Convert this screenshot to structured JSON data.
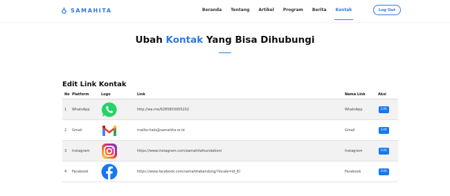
{
  "brand": {
    "name": "SAMAHITA"
  },
  "nav": {
    "links": [
      "Beranda",
      "Tentang",
      "Artikel",
      "Program",
      "Berita",
      "Kontak"
    ],
    "active": "Kontak",
    "logout_label": "Log Out"
  },
  "page": {
    "heading_pre": "Ubah ",
    "heading_accent": "Kontak",
    "heading_post": " Yang Bisa Dihubungi",
    "section_title": "Edit Link Kontak"
  },
  "table": {
    "headers": {
      "no": "No",
      "platform": "Platform",
      "logo": "Logo",
      "link": "Link",
      "name": "Nama Link",
      "aksi": "Aksi"
    },
    "rows": [
      {
        "no": "1",
        "platform": "WhatsApp",
        "logo": "whatsapp-logo",
        "link": "http://wa.me/6285803005202",
        "name": "WhatsApp",
        "action": "Edit"
      },
      {
        "no": "2",
        "platform": "Gmail",
        "logo": "gmail-logo",
        "link": "mailto:halo@samahita.or.id",
        "name": "Gmail",
        "action": "Edit"
      },
      {
        "no": "3",
        "platform": "Instagram",
        "logo": "instagram-logo",
        "link": "https://www.instagram.com/samahitafoundation/",
        "name": "Instagram",
        "action": "Edit"
      },
      {
        "no": "4",
        "platform": "Facebook",
        "logo": "facebook-logo",
        "link": "https://www.facebook.com/samahitabandung/?locale=id_ID",
        "name": "Facebook",
        "action": "Edit"
      }
    ]
  },
  "colors": {
    "accent": "#2a78e4",
    "edit_button": "#1779f0",
    "row_alt": "#f2f2f2"
  }
}
